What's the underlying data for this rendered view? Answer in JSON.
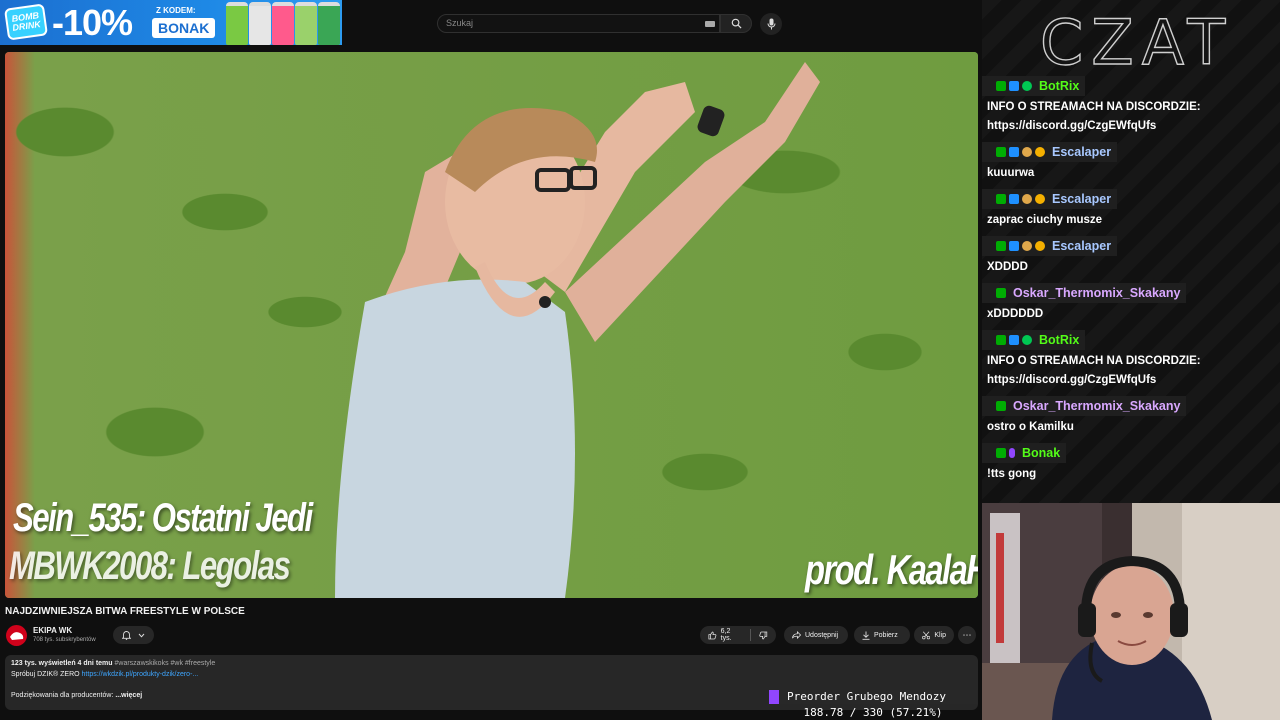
{
  "promo": {
    "logo_text": "BOMB DRINK",
    "discount": "-10%",
    "code_label": "Z KODEM:",
    "code": "BONAK",
    "can_colors": [
      "#7ac943",
      "#e6e6e6",
      "#ff5a8c",
      "#9ad16b",
      "#3aa655"
    ]
  },
  "youtube": {
    "search_placeholder": "Szukaj",
    "video": {
      "credit_line_1": "Sein_535: Ostatni Jedi",
      "credit_line_2": "MBWK2008: Legolas",
      "producer": "prod. KaalaH"
    },
    "title": "NAJDZIWNIEJSZA BITWA FREESTYLE W POLSCE",
    "channel": {
      "name": "EKIPA WK",
      "subscribers": "708 tys. subskrybentów"
    },
    "actions": {
      "likes": "6,2 tys.",
      "share": "Udostępnij",
      "download": "Pobierz",
      "clip": "Klip"
    },
    "description": {
      "stats": "123 tys. wyświetleń  4 dni temu",
      "tags": "#warszawskikoks #wk #freestyle",
      "line2_prefix": "Spróbuj DZIK® ZERO",
      "line2_link": "https://wkdzik.pl/produkty-dzik/zero-...",
      "line3": "Podziękowania dla producentów:",
      "more": "...więcej"
    }
  },
  "music": {
    "now_playing": "Preorder Grubego Mendozy",
    "progress": "188.78 / 330 (57.21%)"
  },
  "chat": {
    "title": "CZAT",
    "messages": [
      {
        "user": "BotRix",
        "color": "#53fc18",
        "badges": [
          "mod",
          "vip",
          "check"
        ],
        "text": "INFO O STREAMACH NA DISCORDZIE:\nhttps://discord.gg/CzgEWfqUfs"
      },
      {
        "user": "Escalaper",
        "color": "#a8c8ff",
        "badges": [
          "mod",
          "vip",
          "sub",
          "bits"
        ],
        "text": "kuuurwa"
      },
      {
        "user": "Escalaper",
        "color": "#a8c8ff",
        "badges": [
          "mod",
          "vip",
          "sub",
          "bits"
        ],
        "text": "zaprac ciuchy musze"
      },
      {
        "user": "Escalaper",
        "color": "#a8c8ff",
        "badges": [
          "mod",
          "vip",
          "sub",
          "bits"
        ],
        "text": "XDDDD"
      },
      {
        "user": "Oskar_Thermomix_Skakany",
        "color": "#d9a8ff",
        "badges": [
          "mod"
        ],
        "text": "xDDDDDD"
      },
      {
        "user": "BotRix",
        "color": "#53fc18",
        "badges": [
          "mod",
          "vip",
          "check"
        ],
        "text": "INFO O STREAMACH NA DISCORDZIE:\nhttps://discord.gg/CzgEWfqUfs"
      },
      {
        "user": "Oskar_Thermomix_Skakany",
        "color": "#d9a8ff",
        "badges": [
          "mod"
        ],
        "text": "ostro o Kamilku"
      },
      {
        "user": "Bonak",
        "color": "#53fc18",
        "badges": [
          "mod",
          "mic"
        ],
        "text": "!tts gong"
      }
    ]
  }
}
